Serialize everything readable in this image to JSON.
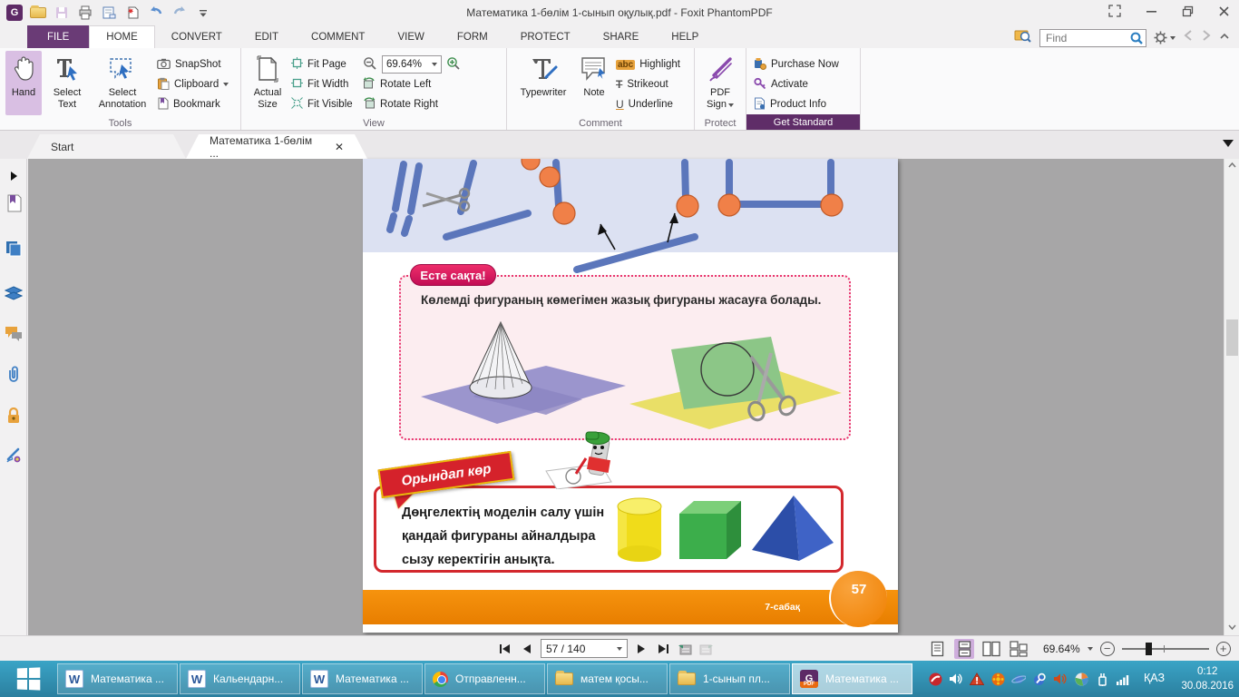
{
  "window": {
    "title": "Математика 1-бөлім 1-сынып оқулық.pdf - Foxit PhantomPDF"
  },
  "find": {
    "placeholder": "Find"
  },
  "ribbon": {
    "tabs": [
      "FILE",
      "HOME",
      "CONVERT",
      "EDIT",
      "COMMENT",
      "VIEW",
      "FORM",
      "PROTECT",
      "SHARE",
      "HELP"
    ],
    "tools": {
      "label": "Tools",
      "hand": "Hand",
      "select_text": "Select Text",
      "select_annotation": "Select Annotation",
      "snapshot": "SnapShot",
      "clipboard": "Clipboard",
      "bookmark": "Bookmark"
    },
    "view": {
      "label": "View",
      "actual_size": "Actual Size",
      "fit_page": "Fit Page",
      "fit_width": "Fit Width",
      "fit_visible": "Fit Visible",
      "zoom_value": "69.64%",
      "rotate_left": "Rotate Left",
      "rotate_right": "Rotate Right"
    },
    "comment": {
      "label": "Comment",
      "typewriter": "Typewriter",
      "note": "Note",
      "highlight": "Highlight",
      "strikeout": "Strikeout",
      "underline": "Underline",
      "abc": "abc",
      "u": "U",
      "t": "T"
    },
    "protect": {
      "label": "Protect",
      "pdf_sign": "PDF Sign"
    },
    "get_standard": {
      "label": "Get Standard",
      "purchase_now": "Purchase Now",
      "activate": "Activate",
      "product_info": "Product Info"
    }
  },
  "doc_tabs": {
    "start": "Start",
    "active": "Математика 1-бөлім ...",
    "close": "✕"
  },
  "page": {
    "remember_badge": "Есте сақта!",
    "remember_text": "Көлемді фигураның көмегімен жазық фигураны жасауға болады.",
    "try_badge": "Орындап көр",
    "task_line1": "Дөңгелектің моделін салу үшін",
    "task_line2": "қандай фигураны айналдыра",
    "task_line3": "сызу керектігін анықта.",
    "lesson": "7-сабақ",
    "page_number": "57"
  },
  "status": {
    "page_indicator": "57 / 140",
    "zoom": "69.64%"
  },
  "taskbar": {
    "buttons": [
      {
        "label": "Математика ..."
      },
      {
        "label": "Кальендарн..."
      },
      {
        "label": "Математика ..."
      },
      {
        "label": "Отправленн..."
      },
      {
        "label": "матем қосы..."
      },
      {
        "label": "1-сынып пл..."
      },
      {
        "label": "Математика ..."
      }
    ],
    "tray": {
      "language": "ҚАЗ",
      "time": "0:12",
      "date": "30.08.2016"
    }
  },
  "icons": {
    "word_w": "W",
    "foxit_g": "G",
    "foxit_pdf": "PDF"
  }
}
